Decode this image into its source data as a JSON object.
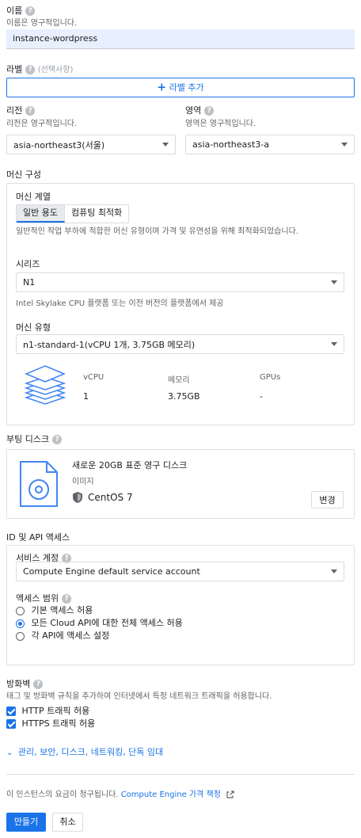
{
  "name": {
    "label": "이름",
    "sub": "이름은 영구적입니다.",
    "value": "instance-wordpress"
  },
  "labels": {
    "label": "라벨",
    "optional": "(선택사항)",
    "add_button": "라벨 추가"
  },
  "region": {
    "label": "리전",
    "sub": "리전은 영구적입니다.",
    "value": "asia-northeast3(서울)"
  },
  "zone": {
    "label": "영역",
    "sub": "영역은 영구적입니다.",
    "value": "asia-northeast3-a"
  },
  "machine": {
    "title": "머신 구성",
    "family_label": "머신 계열",
    "tabs": [
      "일반 용도",
      "컴퓨팅 최적화"
    ],
    "family_desc": "일반적인 작업 부하에 적합한 머신 유형이며 가격 및 유연성을 위해 최적화되었습니다.",
    "series_label": "시리즈",
    "series_value": "N1",
    "series_desc": "Intel Skylake CPU 플랫폼 또는 이전 버전의 플랫폼에서 제공",
    "type_label": "머신 유형",
    "type_value": "n1-standard-1(vCPU 1개, 3.75GB 메모리)",
    "specs": {
      "headers": [
        "vCPU",
        "메모리",
        "GPUs"
      ],
      "values": [
        "1",
        "3.75GB",
        "-"
      ]
    }
  },
  "boot_disk": {
    "title": "부팅 디스크",
    "disk_title": "새로운 20GB 표준 영구 디스크",
    "image_label": "이미지",
    "image_value": "CentOS 7",
    "change_button": "변경"
  },
  "identity": {
    "title": "ID 및 API 액세스",
    "service_account_label": "서비스 계정",
    "service_account_value": "Compute Engine default service account",
    "scopes_label": "액세스 범위",
    "scopes": [
      {
        "label": "기본 액세스 허용",
        "selected": false
      },
      {
        "label": "모든 Cloud API에 대한 전체 액세스 허용",
        "selected": true
      },
      {
        "label": "각 API에 액세스 설정",
        "selected": false
      }
    ]
  },
  "firewall": {
    "title": "방화벽",
    "desc": "태그 및 방화벽 규칙을 추가하여 인터넷에서 특정 네트워크 트래픽을 허용합니다.",
    "http": "HTTP 트래픽 허용",
    "https": "HTTPS 트래픽 허용"
  },
  "advanced_link": "관리, 보안, 디스크, 네트워킹, 단독 임대",
  "billing": {
    "text": "이 인스턴스의 요금이 청구됩니다.",
    "link": "Compute Engine 가격 책정"
  },
  "actions": {
    "create": "만들기",
    "cancel": "취소"
  },
  "colors": {
    "accent": "#1a73e8",
    "input_bg": "#e8f0fe"
  }
}
